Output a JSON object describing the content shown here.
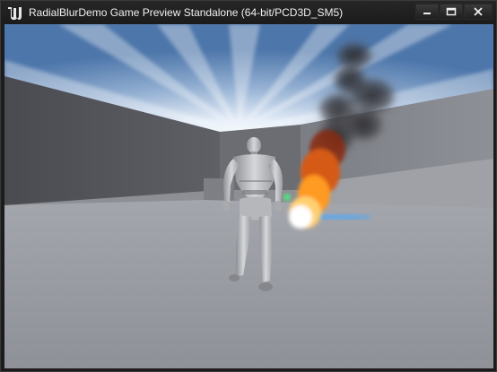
{
  "window": {
    "title": "RadialBlurDemo Game Preview Standalone (64-bit/PCD3D_SM5)",
    "app_icon": "unreal-engine-icon",
    "controls": {
      "minimize_icon": "minimize-icon",
      "maximize_icon": "maximize-icon",
      "close_icon": "close-icon"
    }
  },
  "scene": {
    "sky_color": "#5a7fb0",
    "floor_color": "#9a9ca3",
    "wall_color": "#5d5f66",
    "fire_color": "#ff8a1e",
    "smoke_color": "#3a3a3e",
    "character": "mannequin"
  }
}
